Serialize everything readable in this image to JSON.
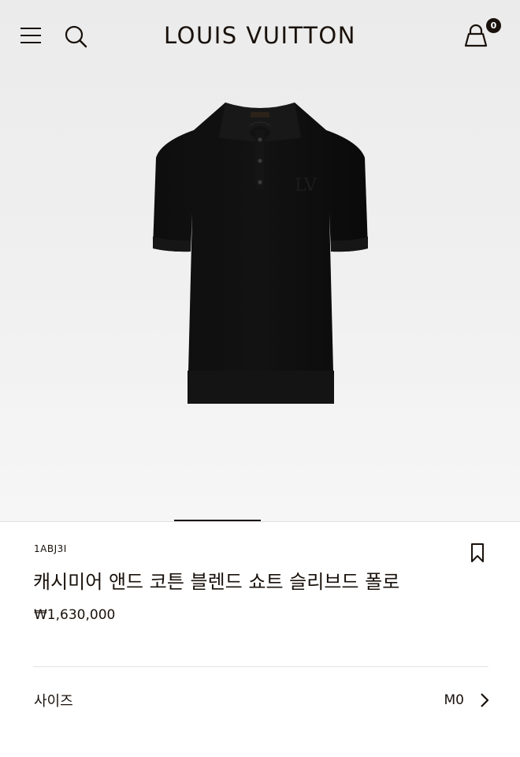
{
  "header": {
    "brand": "LOUIS VUITTON",
    "cart_count": "0",
    "icons": [
      "menu-icon",
      "search-icon",
      "shopping-bag-icon"
    ]
  },
  "product": {
    "sku": "1ABJ3I",
    "title": "캐시미어 앤드 코튼 블렌드 쇼트 슬리브드 폴로",
    "price": "₩1,630,000",
    "image": "black-polo-shirt",
    "image_alt": "캐시미어 앤드 코튼 블렌드 쇼트 슬리브드 폴로"
  },
  "size": {
    "label": "사이즈",
    "value": "M0"
  },
  "colors": {
    "text": "#19110b",
    "background_top": "#ebebeb",
    "background_bottom": "#f6f6f6",
    "divider": "#e1e1e1",
    "product": "#0b0b0b"
  }
}
